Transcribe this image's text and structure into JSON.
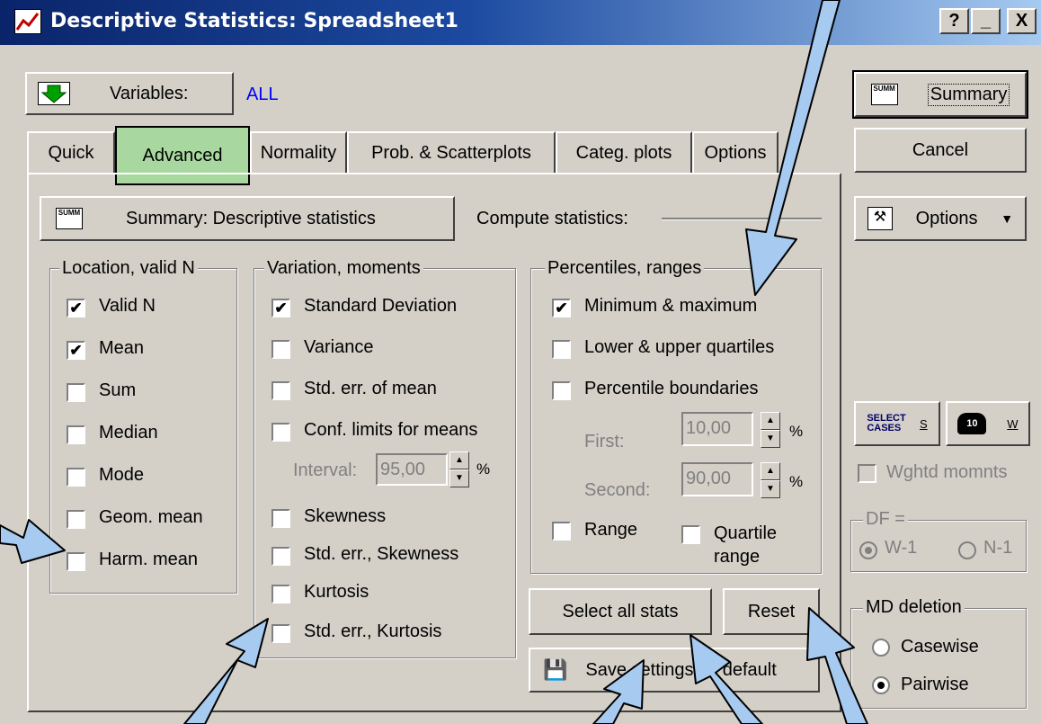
{
  "window": {
    "title": "Descriptive Statistics: Spreadsheet1",
    "help_glyph": "?",
    "minimize_glyph": "_",
    "close_glyph": "X"
  },
  "variables": {
    "button_label": "Variables:",
    "value": "ALL"
  },
  "tabs": [
    {
      "label": "Quick"
    },
    {
      "label": "Advanced"
    },
    {
      "label": "Normality"
    },
    {
      "label": "Prob. & Scatterplots"
    },
    {
      "label": "Categ. plots"
    },
    {
      "label": "Options"
    }
  ],
  "summary_descriptive": {
    "label": "Summary: Descriptive statistics",
    "icon_text": "SUMM"
  },
  "compute_label": "Compute statistics:",
  "location_group": {
    "title": "Location, valid N",
    "items": [
      {
        "label": "Valid N",
        "checked": true
      },
      {
        "label": "Mean",
        "checked": true
      },
      {
        "label": "Sum",
        "checked": false
      },
      {
        "label": "Median",
        "checked": false
      },
      {
        "label": "Mode",
        "checked": false
      },
      {
        "label": "Geom. mean",
        "checked": false
      },
      {
        "label": "Harm. mean",
        "checked": false
      }
    ]
  },
  "variation_group": {
    "title": "Variation, moments",
    "items": [
      {
        "label": "Standard Deviation",
        "checked": true
      },
      {
        "label": "Variance",
        "checked": false
      },
      {
        "label": "Std. err. of mean",
        "checked": false
      },
      {
        "label": "Conf. limits for means",
        "checked": false
      },
      {
        "label": "Skewness",
        "checked": false
      },
      {
        "label": "Std. err., Skewness",
        "checked": false
      },
      {
        "label": "Kurtosis",
        "checked": false
      },
      {
        "label": "Std. err., Kurtosis",
        "checked": false
      }
    ],
    "interval_label": "Interval:",
    "interval_value": "95,00",
    "percent": "%"
  },
  "percentiles_group": {
    "title": "Percentiles, ranges",
    "items": [
      {
        "label": "Minimum & maximum",
        "checked": true
      },
      {
        "label": "Lower & upper quartiles",
        "checked": false
      },
      {
        "label": "Percentile boundaries",
        "checked": false
      }
    ],
    "first_label": "First:",
    "first_value": "10,00",
    "second_label": "Second:",
    "second_value": "90,00",
    "percent": "%",
    "range_label": "Range",
    "quartile_label_1": "Quartile",
    "quartile_label_2": "range"
  },
  "buttons": {
    "select_all": "Select all stats",
    "reset": "Reset",
    "save_settings": "Save settings as default",
    "summary": "Summary",
    "cancel": "Cancel",
    "options": "Options"
  },
  "right_panel": {
    "select_cases_icon": "SELECT CASES",
    "select_cases_key": "S",
    "weight_key": "W",
    "weight_icon_text": "10",
    "wghtd_label": "Wghtd momnts",
    "df_title": "DF =",
    "df_options": [
      {
        "label": "W-1",
        "selected": true
      },
      {
        "label": "N-1",
        "selected": false
      }
    ],
    "md_title": "MD deletion",
    "md_options": [
      {
        "label": "Casewise",
        "selected": false
      },
      {
        "label": "Pairwise",
        "selected": true
      }
    ]
  },
  "colors": {
    "accent_title": "#0a246a",
    "variables_value": "#0000ff",
    "highlight_tab": "#a8d8a0",
    "arrow_fill": "#a6caf0"
  }
}
